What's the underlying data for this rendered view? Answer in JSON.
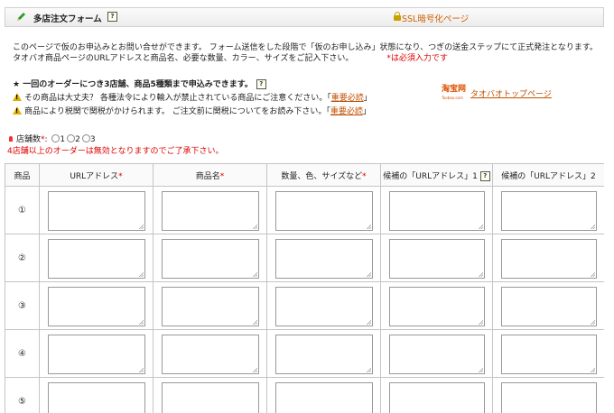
{
  "header": {
    "title": "多店注文フォーム",
    "help_mark": "?",
    "ssl_label": "SSL暗号化ページ"
  },
  "intro": {
    "line1": "このページで仮のお申込みとお問い合せができます。 フォーム送信をした段階で「仮のお申し込み」状態になり、つぎの送金ステップにて正式発注となります。",
    "line2": "タオバオ商品ページのURLアドレスと商品名、必要な数量、カラー、サイズをご記入下さい。",
    "required_note": "*は必須入力です"
  },
  "notice": {
    "heading": "★ 一回のオーダーにつき3店舗、商品5種類まで申込みできます。",
    "help_mark": "?",
    "warnings": [
      {
        "text": "その商品は大丈夫？ 各種法令により輸入が禁止されている商品にご注意ください。「",
        "link": "重要必読",
        "tail": "」"
      },
      {
        "text": "商品により税関で関税がかけられます。 ご注文前に関税についてをお読み下さい。「",
        "link": "重要必読",
        "tail": "」"
      }
    ]
  },
  "taobao": {
    "logo": "淘宝网",
    "logo_sub": "Taobao.com",
    "link": "タオバオトップページ"
  },
  "stores": {
    "label": "店舗数",
    "required_mark": "*",
    "options": [
      "1",
      "2",
      "3"
    ],
    "warning": "4店舗以上のオーダーは無効となりますのでご了承下さい。"
  },
  "table": {
    "headers": [
      {
        "label": "商品",
        "req": ""
      },
      {
        "label": "URLアドレス",
        "req": "*"
      },
      {
        "label": "商品名",
        "req": "*"
      },
      {
        "label": "数量、色、サイズなど",
        "req": "*"
      },
      {
        "label": "候補の「URLアドレス」1",
        "req": "",
        "help": "?"
      },
      {
        "label": "候補の「URLアドレス」2",
        "req": ""
      }
    ],
    "rows": [
      "①",
      "②",
      "③",
      "④",
      "⑤"
    ]
  },
  "colors": {
    "accent": "#d06000",
    "required": "#dd0000",
    "border": "#c4c4c4"
  }
}
